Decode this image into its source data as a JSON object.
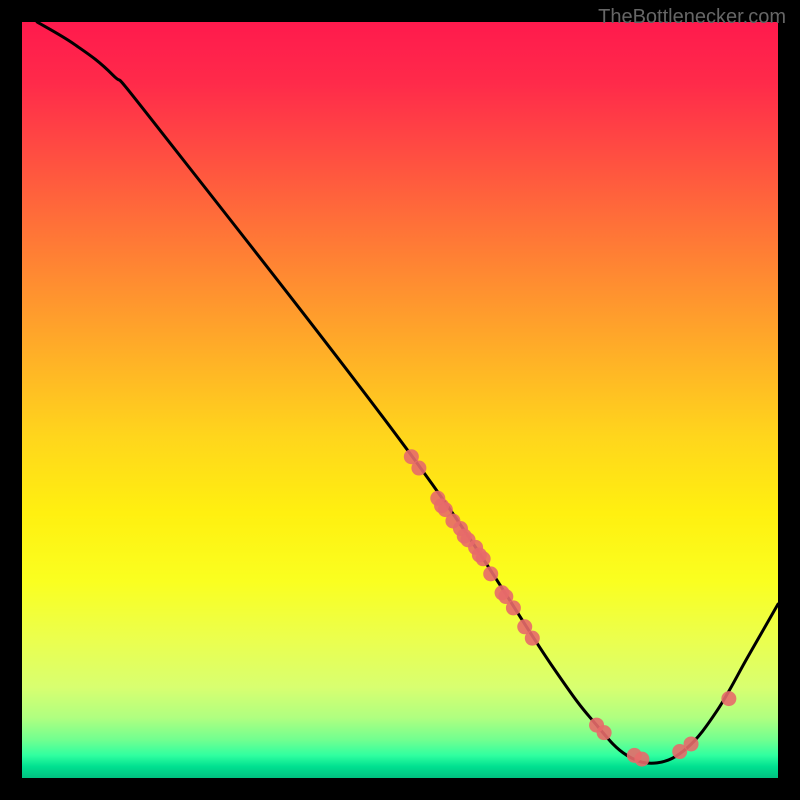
{
  "watermark": "TheBottlenecker.com",
  "chart_data": {
    "type": "line",
    "title": "",
    "xlabel": "",
    "ylabel": "",
    "xlim": [
      0,
      100
    ],
    "ylim": [
      0,
      100
    ],
    "grid": false,
    "curve": [
      {
        "x": 2,
        "y": 100
      },
      {
        "x": 7,
        "y": 97
      },
      {
        "x": 12,
        "y": 93
      },
      {
        "x": 18,
        "y": 86
      },
      {
        "x": 52,
        "y": 42
      },
      {
        "x": 70,
        "y": 15
      },
      {
        "x": 76,
        "y": 7
      },
      {
        "x": 80,
        "y": 3
      },
      {
        "x": 84,
        "y": 2
      },
      {
        "x": 88,
        "y": 4
      },
      {
        "x": 92,
        "y": 9
      },
      {
        "x": 96,
        "y": 16
      },
      {
        "x": 100,
        "y": 23
      }
    ],
    "markers": [
      {
        "x": 51.5,
        "y": 42.5
      },
      {
        "x": 52.5,
        "y": 41
      },
      {
        "x": 55,
        "y": 37
      },
      {
        "x": 55.5,
        "y": 36
      },
      {
        "x": 56,
        "y": 35.5
      },
      {
        "x": 57,
        "y": 34
      },
      {
        "x": 58,
        "y": 33
      },
      {
        "x": 58.5,
        "y": 32
      },
      {
        "x": 59,
        "y": 31.5
      },
      {
        "x": 60,
        "y": 30.5
      },
      {
        "x": 60.5,
        "y": 29.5
      },
      {
        "x": 61,
        "y": 29
      },
      {
        "x": 62,
        "y": 27
      },
      {
        "x": 63.5,
        "y": 24.5
      },
      {
        "x": 64,
        "y": 24
      },
      {
        "x": 65,
        "y": 22.5
      },
      {
        "x": 66.5,
        "y": 20
      },
      {
        "x": 67.5,
        "y": 18.5
      },
      {
        "x": 76,
        "y": 7
      },
      {
        "x": 77,
        "y": 6
      },
      {
        "x": 81,
        "y": 3
      },
      {
        "x": 82,
        "y": 2.5
      },
      {
        "x": 87,
        "y": 3.5
      },
      {
        "x": 88.5,
        "y": 4.5
      },
      {
        "x": 93.5,
        "y": 10.5
      }
    ],
    "gradient_stops": [
      {
        "pos": 0,
        "color": "#ff1a4d"
      },
      {
        "pos": 8,
        "color": "#ff2a4a"
      },
      {
        "pos": 15,
        "color": "#ff4444"
      },
      {
        "pos": 25,
        "color": "#ff6a3a"
      },
      {
        "pos": 35,
        "color": "#ff8f30"
      },
      {
        "pos": 45,
        "color": "#ffb326"
      },
      {
        "pos": 55,
        "color": "#ffd61c"
      },
      {
        "pos": 65,
        "color": "#fff010"
      },
      {
        "pos": 74,
        "color": "#faff20"
      },
      {
        "pos": 82,
        "color": "#eaff50"
      },
      {
        "pos": 88,
        "color": "#d8ff70"
      },
      {
        "pos": 92,
        "color": "#b0ff80"
      },
      {
        "pos": 95,
        "color": "#70ff90"
      },
      {
        "pos": 97,
        "color": "#30ffa0"
      },
      {
        "pos": 98.5,
        "color": "#00e090"
      },
      {
        "pos": 100,
        "color": "#00c080"
      }
    ],
    "marker_color": "#e76a6a",
    "curve_color": "#000000"
  }
}
